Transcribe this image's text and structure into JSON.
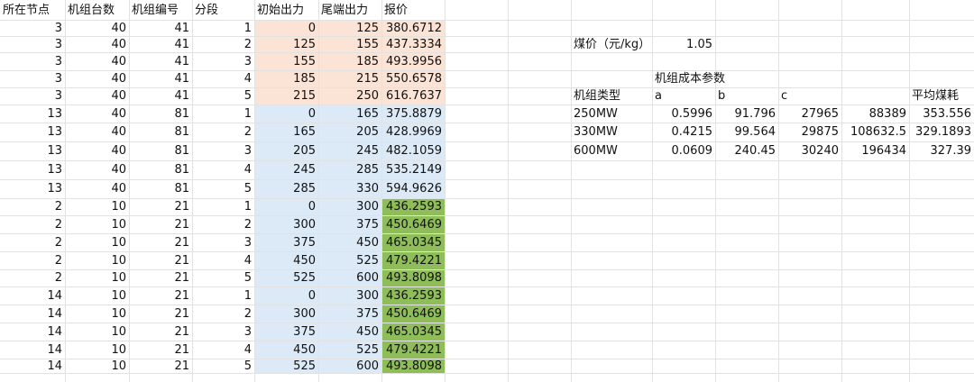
{
  "left_table": {
    "headers": [
      "所在节点",
      "机组台数",
      "机组编号",
      "分段",
      "初始出力",
      "尾端出力",
      "报价"
    ],
    "rows": [
      [
        "3",
        "40",
        "41",
        "1",
        "0",
        "125",
        "380.6712"
      ],
      [
        "3",
        "40",
        "41",
        "2",
        "125",
        "155",
        "437.3334"
      ],
      [
        "3",
        "40",
        "41",
        "3",
        "155",
        "185",
        "493.9956"
      ],
      [
        "3",
        "40",
        "41",
        "4",
        "185",
        "215",
        "550.6578"
      ],
      [
        "3",
        "40",
        "41",
        "5",
        "215",
        "250",
        "616.7637"
      ],
      [
        "13",
        "40",
        "81",
        "1",
        "0",
        "165",
        "375.8879"
      ],
      [
        "13",
        "40",
        "81",
        "2",
        "165",
        "205",
        "428.9969"
      ],
      [
        "13",
        "40",
        "81",
        "3",
        "205",
        "245",
        "482.1059"
      ],
      [
        "13",
        "40",
        "81",
        "4",
        "245",
        "285",
        "535.2149"
      ],
      [
        "13",
        "40",
        "81",
        "5",
        "285",
        "330",
        "594.9626"
      ],
      [
        "2",
        "10",
        "21",
        "1",
        "0",
        "300",
        "436.2593"
      ],
      [
        "2",
        "10",
        "21",
        "2",
        "300",
        "375",
        "450.6469"
      ],
      [
        "2",
        "10",
        "21",
        "3",
        "375",
        "450",
        "465.0345"
      ],
      [
        "2",
        "10",
        "21",
        "4",
        "450",
        "525",
        "479.4221"
      ],
      [
        "2",
        "10",
        "21",
        "5",
        "525",
        "600",
        "493.8098"
      ],
      [
        "14",
        "10",
        "21",
        "1",
        "0",
        "300",
        "436.2593"
      ],
      [
        "14",
        "10",
        "21",
        "2",
        "300",
        "375",
        "450.6469"
      ],
      [
        "14",
        "10",
        "21",
        "3",
        "375",
        "450",
        "465.0345"
      ],
      [
        "14",
        "10",
        "21",
        "4",
        "450",
        "525",
        "479.4221"
      ],
      [
        "14",
        "10",
        "21",
        "5",
        "525",
        "600",
        "493.8098"
      ]
    ]
  },
  "coal_price": {
    "label": "煤价（元/kg）",
    "value": "1.05"
  },
  "cost_params": {
    "title": "机组成本参数",
    "headers": [
      "机组类型",
      "a",
      "b",
      "c",
      "",
      "平均煤耗"
    ],
    "rows": [
      [
        "250MW",
        "0.5996",
        "91.796",
        "27965",
        "88389",
        "353.556"
      ],
      [
        "330MW",
        "0.4215",
        "99.564",
        "29875",
        "108632.5",
        "329.1893"
      ],
      [
        "600MW",
        "0.0609",
        "240.45",
        "30240",
        "196434",
        "327.39"
      ]
    ]
  },
  "colors": {
    "fill_peach": "#fbe3d6",
    "fill_blue": "#dceaf7",
    "fill_green": "#8fbd5a",
    "gridline": "#e2e2e2"
  }
}
